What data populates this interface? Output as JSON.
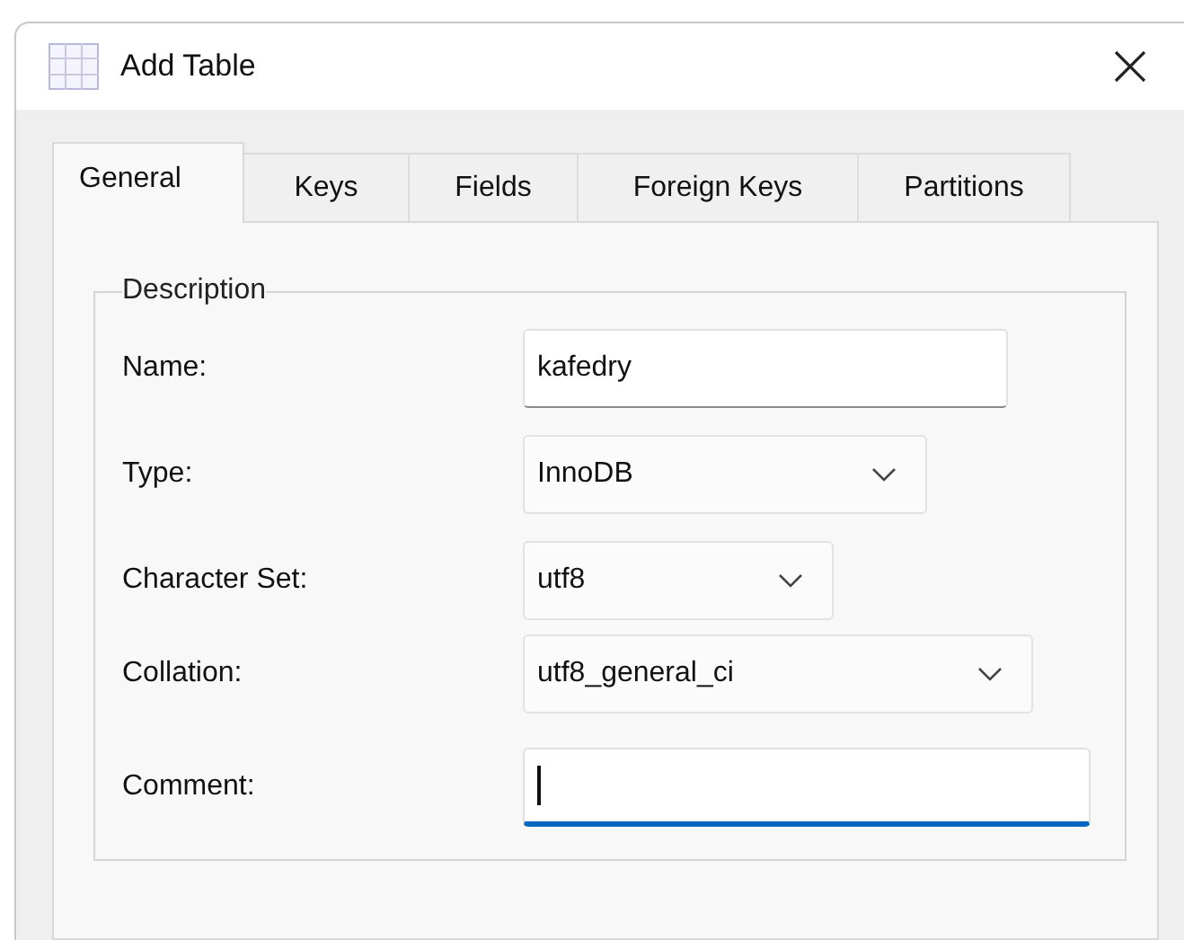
{
  "window": {
    "title": "Add Table"
  },
  "tabs": [
    {
      "label": "General",
      "selected": true
    },
    {
      "label": "Keys",
      "selected": false
    },
    {
      "label": "Fields",
      "selected": false
    },
    {
      "label": "Foreign Keys",
      "selected": false
    },
    {
      "label": "Partitions",
      "selected": false
    }
  ],
  "group": {
    "title": "Description"
  },
  "fields": [
    {
      "label": "Name:",
      "kind": "text",
      "value": "kafedry",
      "focused": false
    },
    {
      "label": "Type:",
      "kind": "dropdown",
      "value": "InnoDB"
    },
    {
      "label": "Character Set:",
      "kind": "dropdown",
      "value": "utf8"
    },
    {
      "label": "Collation:",
      "kind": "dropdown",
      "value": "utf8_general_ci"
    },
    {
      "label": "Comment:",
      "kind": "text",
      "focused": true
    }
  ]
}
